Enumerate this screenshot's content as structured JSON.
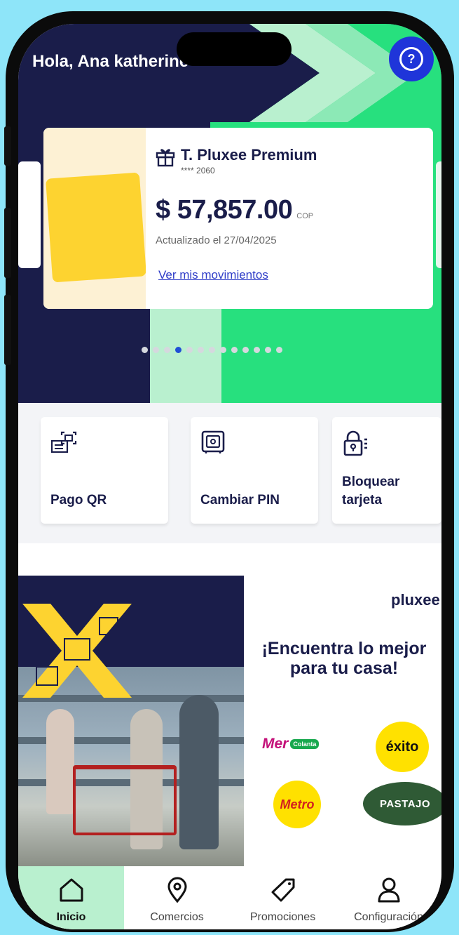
{
  "header": {
    "greeting": "Hola, Ana katherine",
    "help_icon": "question-circle-icon",
    "help_label": "?"
  },
  "card": {
    "name": "T. Pluxee Premium",
    "masked_number": "**** 2060",
    "balance": "$ 57,857.00",
    "currency": "COP",
    "updated": "Actualizado el 27/04/2025",
    "link": "Ver mis movimientos",
    "icon": "gift-icon"
  },
  "carousel": {
    "total_pages": 13,
    "active_index": 3
  },
  "actions": [
    {
      "label": "Pago QR",
      "icon": "qr-scan-icon"
    },
    {
      "label": "Cambiar PIN",
      "icon": "safe-icon"
    },
    {
      "label": "Bloquear tarjeta",
      "icon": "lock-card-icon"
    }
  ],
  "banner": {
    "brand": "pluxee",
    "headline": "¡Encuentra lo mejor para tu casa!",
    "partners": [
      "Mer",
      "Colanta",
      "éxito",
      "Metro",
      "PASTAJO"
    ]
  },
  "tabs": [
    {
      "label": "Inicio",
      "icon": "home-icon",
      "active": true
    },
    {
      "label": "Comercios",
      "icon": "location-pin-icon",
      "active": false
    },
    {
      "label": "Promociones",
      "icon": "tag-icon",
      "active": false
    },
    {
      "label": "Configuración",
      "icon": "user-icon",
      "active": false
    }
  ],
  "colors": {
    "navy": "#1a1d4a",
    "green": "#27e07e",
    "mint": "#b9f0cf",
    "blue": "#1f35d9",
    "yellow": "#fdd330"
  }
}
